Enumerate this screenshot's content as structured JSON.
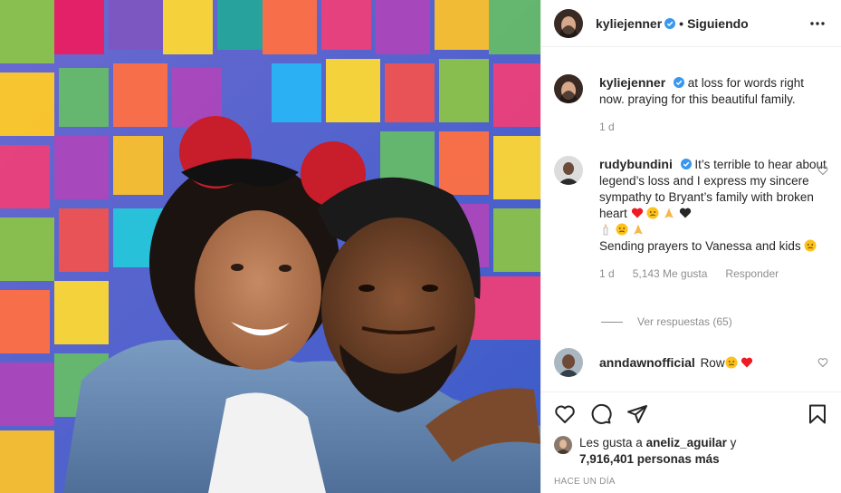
{
  "post": {
    "photo_alt": "",
    "header": {
      "username": "kyliejenner",
      "separator": "•",
      "follow_status": "Siguiendo"
    },
    "caption": {
      "username": "kyliejenner",
      "text": "at loss for words right now. praying for this beautiful family.",
      "time": "1 d"
    },
    "comments": [
      {
        "username": "rudybundini",
        "text_1": "It’s terrible to hear about legend’s loss and I express my sincere sympathy to Bryant’s family with broken heart",
        "text_2": "Sending prayers to Vanessa and kids",
        "time": "1 d",
        "likes": "5,143 Me gusta",
        "reply_label": "Responder",
        "view_replies": "Ver respuestas (65)"
      },
      {
        "username": "anndawnofficial",
        "text": "Row"
      }
    ],
    "likes": {
      "prefix": "Les gusta a",
      "user": "aneliz_aguilar",
      "joiner": "y",
      "others": "7,916,401 personas más"
    },
    "time_ago": "HACE UN DÍA",
    "colors": {
      "verified_blue": "#3897f0",
      "secondary_text": "#8e8e8e",
      "red_heart": "#ed1c24"
    },
    "icons": [
      "verified-icon",
      "more-options-icon",
      "heart-icon",
      "comment-icon",
      "share-icon",
      "save-icon"
    ]
  }
}
